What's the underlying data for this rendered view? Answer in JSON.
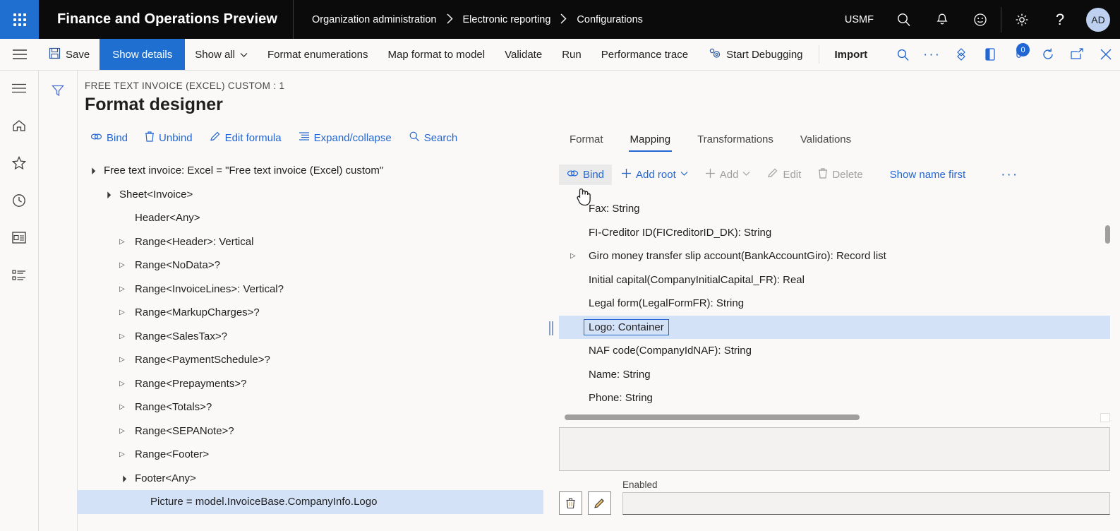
{
  "topbar": {
    "waffle_label": "app-launcher",
    "app_title": "Finance and Operations Preview",
    "breadcrumb": [
      "Organization administration",
      "Electronic reporting",
      "Configurations"
    ],
    "company": "USMF",
    "icons": [
      "search-icon",
      "notifications-bell-icon",
      "feedback-smiley-icon",
      "settings-gear-icon",
      "help-question-icon"
    ],
    "avatar_initials": "AD",
    "accent_blue": "#1f6fd0",
    "bar_background": "#0b0b0b"
  },
  "commandbar": {
    "save_label": "Save",
    "show_details_label": "Show details",
    "show_all_label": "Show all",
    "format_enumerations_label": "Format enumerations",
    "map_format_to_model_label": "Map format to model",
    "validate_label": "Validate",
    "run_label": "Run",
    "performance_trace_label": "Performance trace",
    "start_debugging_label": "Start Debugging",
    "import_label": "Import",
    "notification_count": "0",
    "right_icons": [
      "search-icon",
      "overflow-ellipsis-icon",
      "attachments-icon",
      "office-app-icon",
      "notifications-icon",
      "refresh-icon",
      "open-in-new-window-icon",
      "close-icon"
    ]
  },
  "rail": {
    "icons": [
      "hamburger-menu-icon",
      "home-icon",
      "favorites-star-icon",
      "recent-clock-icon",
      "workspaces-icon",
      "modules-list-icon"
    ]
  },
  "filter_pane": {
    "icon": "filter-funnel-icon"
  },
  "page": {
    "eyebrow": "FREE TEXT INVOICE (EXCEL) CUSTOM : 1",
    "title": "Format designer"
  },
  "format_toolbar": {
    "buttons": [
      {
        "label": "Bind",
        "icon": "bind-link-icon"
      },
      {
        "label": "Unbind",
        "icon": "unbind-trash-icon"
      },
      {
        "label": "Edit formula",
        "icon": "pencil-edit-icon"
      },
      {
        "label": "Expand/collapse",
        "icon": "list-expand-icon"
      },
      {
        "label": "Search",
        "icon": "search-icon"
      }
    ]
  },
  "format_tree": {
    "nodes": [
      {
        "label": "Free text invoice: Excel = \"Free text invoice (Excel) custom\"",
        "indent": 0,
        "state": "open",
        "selected": false
      },
      {
        "label": "Sheet<Invoice>",
        "indent": 1,
        "state": "open",
        "selected": false
      },
      {
        "label": "Header<Any>",
        "indent": 2,
        "state": "none",
        "selected": false
      },
      {
        "label": "Range<Header>: Vertical",
        "indent": 2,
        "state": "closed",
        "selected": false
      },
      {
        "label": "Range<NoData>?",
        "indent": 2,
        "state": "closed",
        "selected": false
      },
      {
        "label": "Range<InvoiceLines>: Vertical?",
        "indent": 2,
        "state": "closed",
        "selected": false
      },
      {
        "label": "Range<MarkupCharges>?",
        "indent": 2,
        "state": "closed",
        "selected": false
      },
      {
        "label": "Range<SalesTax>?",
        "indent": 2,
        "state": "closed",
        "selected": false
      },
      {
        "label": "Range<PaymentSchedule>?",
        "indent": 2,
        "state": "closed",
        "selected": false
      },
      {
        "label": "Range<Prepayments>?",
        "indent": 2,
        "state": "closed",
        "selected": false
      },
      {
        "label": "Range<Totals>?",
        "indent": 2,
        "state": "closed",
        "selected": false
      },
      {
        "label": "Range<SEPANote>?",
        "indent": 2,
        "state": "closed",
        "selected": false
      },
      {
        "label": "Range<Footer>",
        "indent": 2,
        "state": "closed",
        "selected": false
      },
      {
        "label": "Footer<Any>",
        "indent": 2,
        "state": "open",
        "selected": false
      },
      {
        "label": "Picture = model.InvoiceBase.CompanyInfo.Logo",
        "indent": 3,
        "state": "none",
        "selected": true
      }
    ],
    "selected_row_color": "#d4e2f8"
  },
  "right_panel": {
    "tabs": [
      {
        "label": "Format",
        "active": false
      },
      {
        "label": "Mapping",
        "active": true
      },
      {
        "label": "Transformations",
        "active": false
      },
      {
        "label": "Validations",
        "active": false
      }
    ],
    "toolbar": [
      {
        "label": "Bind",
        "icon": "bind-link-icon",
        "state": "pressed"
      },
      {
        "label": "Add root",
        "icon": "plus-icon",
        "state": "enabled",
        "caret": true
      },
      {
        "label": "Add",
        "icon": "plus-icon",
        "state": "disabled",
        "caret": true
      },
      {
        "label": "Edit",
        "icon": "pencil-edit-icon",
        "state": "disabled"
      },
      {
        "label": "Delete",
        "icon": "trash-icon",
        "state": "disabled"
      },
      {
        "label": "Show name first",
        "icon": "",
        "state": "enabled"
      },
      {
        "label": "···",
        "icon": "overflow-ellipsis-icon",
        "state": "enabled"
      }
    ],
    "cursor": "pointing-hand-cursor",
    "data_nodes": [
      {
        "label": "Fax: String",
        "expandable": false,
        "selected": false
      },
      {
        "label": "FI-Creditor ID(FICreditorID_DK): String",
        "expandable": false,
        "selected": false
      },
      {
        "label": "Giro money transfer slip account(BankAccountGiro): Record list",
        "expandable": true,
        "selected": false
      },
      {
        "label": "Initial capital(CompanyInitialCapital_FR): Real",
        "expandable": false,
        "selected": false
      },
      {
        "label": "Legal form(LegalFormFR): String",
        "expandable": false,
        "selected": false
      },
      {
        "label": "Logo: Container",
        "expandable": false,
        "selected": true
      },
      {
        "label": "NAF code(CompanyIdNAF): String",
        "expandable": false,
        "selected": false
      },
      {
        "label": "Name: String",
        "expandable": false,
        "selected": false
      },
      {
        "label": "Phone: String",
        "expandable": false,
        "selected": false
      }
    ],
    "formula_box_value": "",
    "delete_button_icon": "trash-icon",
    "edit_button_icon": "pencil-edit-icon",
    "enabled_label": "Enabled",
    "enabled_value": ""
  }
}
